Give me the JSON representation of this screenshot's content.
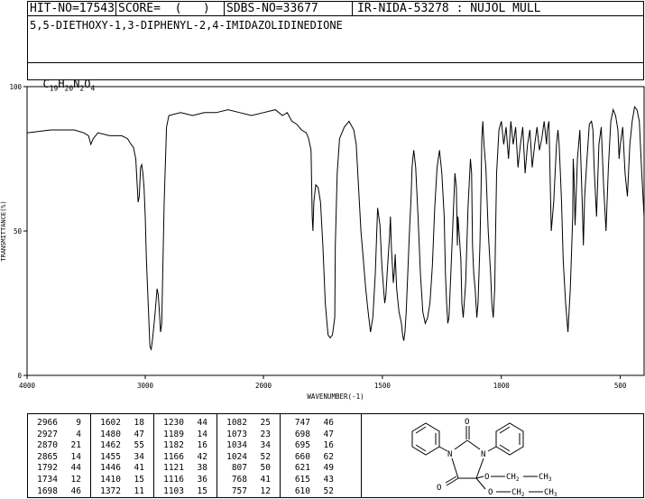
{
  "header": {
    "hit_no": "HIT-NO=17543",
    "score": "SCORE=  (   )",
    "sdbs_no": "SDBS-NO=33677",
    "ir_code": "IR-NIDA-53278 : NUJOL MULL",
    "compound_name": "5,5-DIETHOXY-1,3-DIPHENYL-2,4-IMIDAZOLIDINEDIONE",
    "formula_parts": [
      "C",
      "19",
      "H",
      "20",
      "N",
      "2",
      "O",
      "4"
    ]
  },
  "chart_data": {
    "type": "line",
    "title": "",
    "xlabel": "WAVENUMBER(-1)",
    "ylabel": "TRANSMITTANCE(%)",
    "xlim": [
      4000,
      400
    ],
    "ylim": [
      0,
      100
    ],
    "x_ticks": [
      4000,
      3000,
      2000,
      1500,
      1000,
      500
    ],
    "y_ticks": [
      0,
      50,
      100
    ],
    "grid": false,
    "x": [
      4000,
      3800,
      3600,
      3520,
      3480,
      3460,
      3440,
      3400,
      3300,
      3200,
      3150,
      3120,
      3100,
      3080,
      3060,
      3050,
      3040,
      3030,
      3020,
      3010,
      3000,
      2990,
      2980,
      2960,
      2950,
      2940,
      2930,
      2920,
      2910,
      2900,
      2890,
      2880,
      2870,
      2860,
      2850,
      2840,
      2820,
      2800,
      2700,
      2600,
      2500,
      2400,
      2300,
      2200,
      2100,
      2000,
      1950,
      1920,
      1900,
      1880,
      1860,
      1840,
      1820,
      1810,
      1800,
      1795,
      1792,
      1788,
      1780,
      1770,
      1760,
      1750,
      1740,
      1734,
      1728,
      1720,
      1710,
      1700,
      1698,
      1690,
      1680,
      1660,
      1640,
      1620,
      1610,
      1600,
      1590,
      1580,
      1570,
      1560,
      1550,
      1540,
      1530,
      1520,
      1510,
      1502,
      1495,
      1490,
      1485,
      1480,
      1475,
      1470,
      1466,
      1462,
      1458,
      1454,
      1450,
      1446,
      1440,
      1430,
      1420,
      1415,
      1410,
      1405,
      1400,
      1395,
      1390,
      1385,
      1380,
      1375,
      1372,
      1368,
      1360,
      1350,
      1340,
      1330,
      1320,
      1310,
      1300,
      1290,
      1280,
      1270,
      1260,
      1250,
      1240,
      1235,
      1230,
      1225,
      1220,
      1210,
      1200,
      1195,
      1189,
      1185,
      1182,
      1178,
      1170,
      1166,
      1160,
      1150,
      1140,
      1130,
      1125,
      1121,
      1116,
      1110,
      1103,
      1098,
      1090,
      1085,
      1082,
      1078,
      1073,
      1065,
      1055,
      1045,
      1040,
      1034,
      1028,
      1024,
      1020,
      1010,
      1000,
      990,
      980,
      970,
      960,
      950,
      940,
      930,
      920,
      910,
      900,
      890,
      880,
      870,
      860,
      850,
      840,
      830,
      820,
      810,
      807,
      800,
      790,
      780,
      768,
      762,
      757,
      752,
      747,
      740,
      730,
      720,
      710,
      700,
      698,
      695,
      690,
      680,
      670,
      660,
      655,
      650,
      640,
      630,
      621,
      615,
      610,
      600,
      590,
      580,
      570,
      560,
      550,
      540,
      530,
      520,
      510,
      505,
      500,
      490,
      480,
      470,
      460,
      450,
      440,
      430,
      420,
      410,
      400
    ],
    "y": [
      84,
      85,
      85,
      84,
      83,
      80,
      82,
      84,
      83,
      83,
      82,
      80,
      79,
      75,
      60,
      62,
      72,
      73,
      70,
      65,
      55,
      40,
      30,
      10,
      9,
      12,
      16,
      20,
      25,
      30,
      28,
      22,
      15,
      18,
      40,
      60,
      86,
      90,
      91,
      90,
      91,
      91,
      92,
      91,
      90,
      91,
      92,
      90,
      91,
      88,
      87,
      85,
      84,
      82,
      78,
      55,
      50,
      60,
      66,
      65,
      60,
      45,
      25,
      19,
      14,
      13,
      14,
      20,
      45,
      70,
      82,
      86,
      88,
      85,
      80,
      65,
      50,
      40,
      30,
      22,
      15,
      20,
      35,
      58,
      52,
      38,
      30,
      25,
      28,
      35,
      42,
      48,
      55,
      44,
      38,
      32,
      36,
      42,
      30,
      22,
      18,
      14,
      12,
      15,
      22,
      32,
      42,
      52,
      60,
      72,
      75,
      78,
      72,
      55,
      35,
      22,
      18,
      20,
      25,
      38,
      58,
      72,
      78,
      70,
      55,
      35,
      25,
      18,
      20,
      40,
      60,
      70,
      65,
      45,
      55,
      50,
      40,
      25,
      20,
      32,
      58,
      75,
      70,
      45,
      35,
      30,
      20,
      25,
      45,
      65,
      82,
      88,
      80,
      72,
      50,
      35,
      25,
      20,
      30,
      50,
      70,
      85,
      88,
      80,
      86,
      75,
      88,
      80,
      86,
      72,
      80,
      86,
      70,
      80,
      85,
      72,
      80,
      86,
      78,
      82,
      88,
      80,
      85,
      88,
      50,
      60,
      80,
      85,
      80,
      70,
      60,
      40,
      25,
      15,
      30,
      55,
      75,
      70,
      52,
      75,
      85,
      60,
      45,
      62,
      75,
      87,
      88,
      85,
      72,
      55,
      80,
      86,
      65,
      50,
      72,
      88,
      92,
      90,
      85,
      75,
      80,
      86,
      70,
      62,
      80,
      88,
      93,
      92,
      88,
      70,
      55,
      70,
      90,
      93,
      92,
      91,
      90,
      88,
      85,
      83
    ]
  },
  "peak_table": [
    {
      "wavenumbers": [
        "2966",
        "2927",
        "2870",
        "2865",
        "1792",
        "1734",
        "1698"
      ],
      "intensities": [
        "9",
        "4",
        "21",
        "14",
        "44",
        "12",
        "46"
      ]
    },
    {
      "wavenumbers": [
        "1602",
        "1480",
        "1462",
        "1455",
        "1446",
        "1410",
        "1372"
      ],
      "intensities": [
        "18",
        "47",
        "55",
        "34",
        "41",
        "15",
        "11"
      ]
    },
    {
      "wavenumbers": [
        "1230",
        "1189",
        "1182",
        "1166",
        "1121",
        "1116",
        "1103"
      ],
      "intensities": [
        "44",
        "14",
        "16",
        "42",
        "38",
        "36",
        "15"
      ]
    },
    {
      "wavenumbers": [
        "1082",
        "1073",
        "1034",
        "1024",
        "807",
        "768",
        "757"
      ],
      "intensities": [
        "25",
        "23",
        "34",
        "52",
        "50",
        "41",
        "12"
      ]
    },
    {
      "wavenumbers": [
        "747",
        "698",
        "695",
        "660",
        "621",
        "615",
        "610"
      ],
      "intensities": [
        "46",
        "47",
        "16",
        "62",
        "49",
        "43",
        "52"
      ]
    }
  ],
  "structure": {
    "labels": [
      "O",
      "N",
      "N",
      "O",
      "O",
      "CH",
      "O",
      "CH",
      "CH",
      "CH"
    ],
    "subscripts": [
      "2",
      "3",
      "2",
      "3"
    ]
  }
}
